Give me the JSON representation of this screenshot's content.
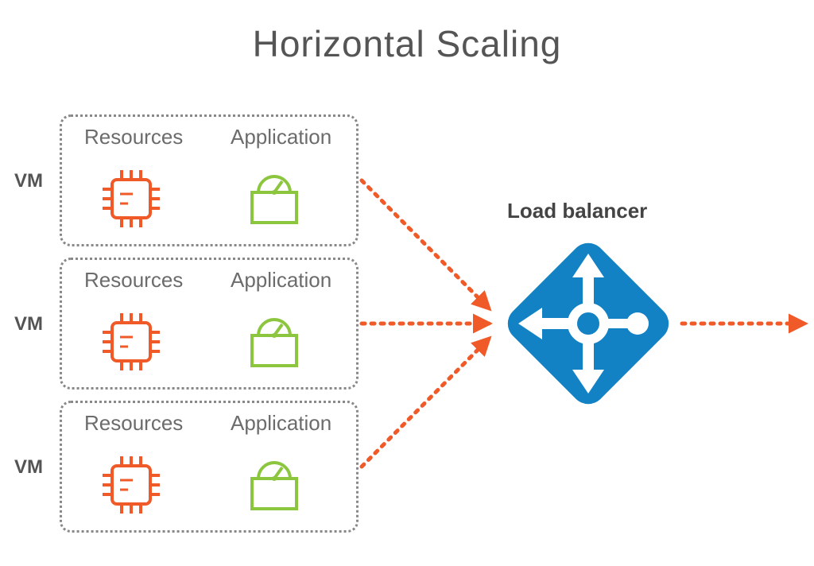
{
  "title": "Horizontal Scaling",
  "vm_label": "VM",
  "columns": {
    "resources": "Resources",
    "application": "Application"
  },
  "load_balancer_label": "Load balancer",
  "vms": [
    {
      "id": "vm1"
    },
    {
      "id": "vm2"
    },
    {
      "id": "vm3"
    }
  ],
  "colors": {
    "cpu": "#F05A28",
    "app": "#8CC63F",
    "lb": "#1282C5",
    "arrow": "#F05A28",
    "border": "#888888",
    "text": "#555555"
  }
}
